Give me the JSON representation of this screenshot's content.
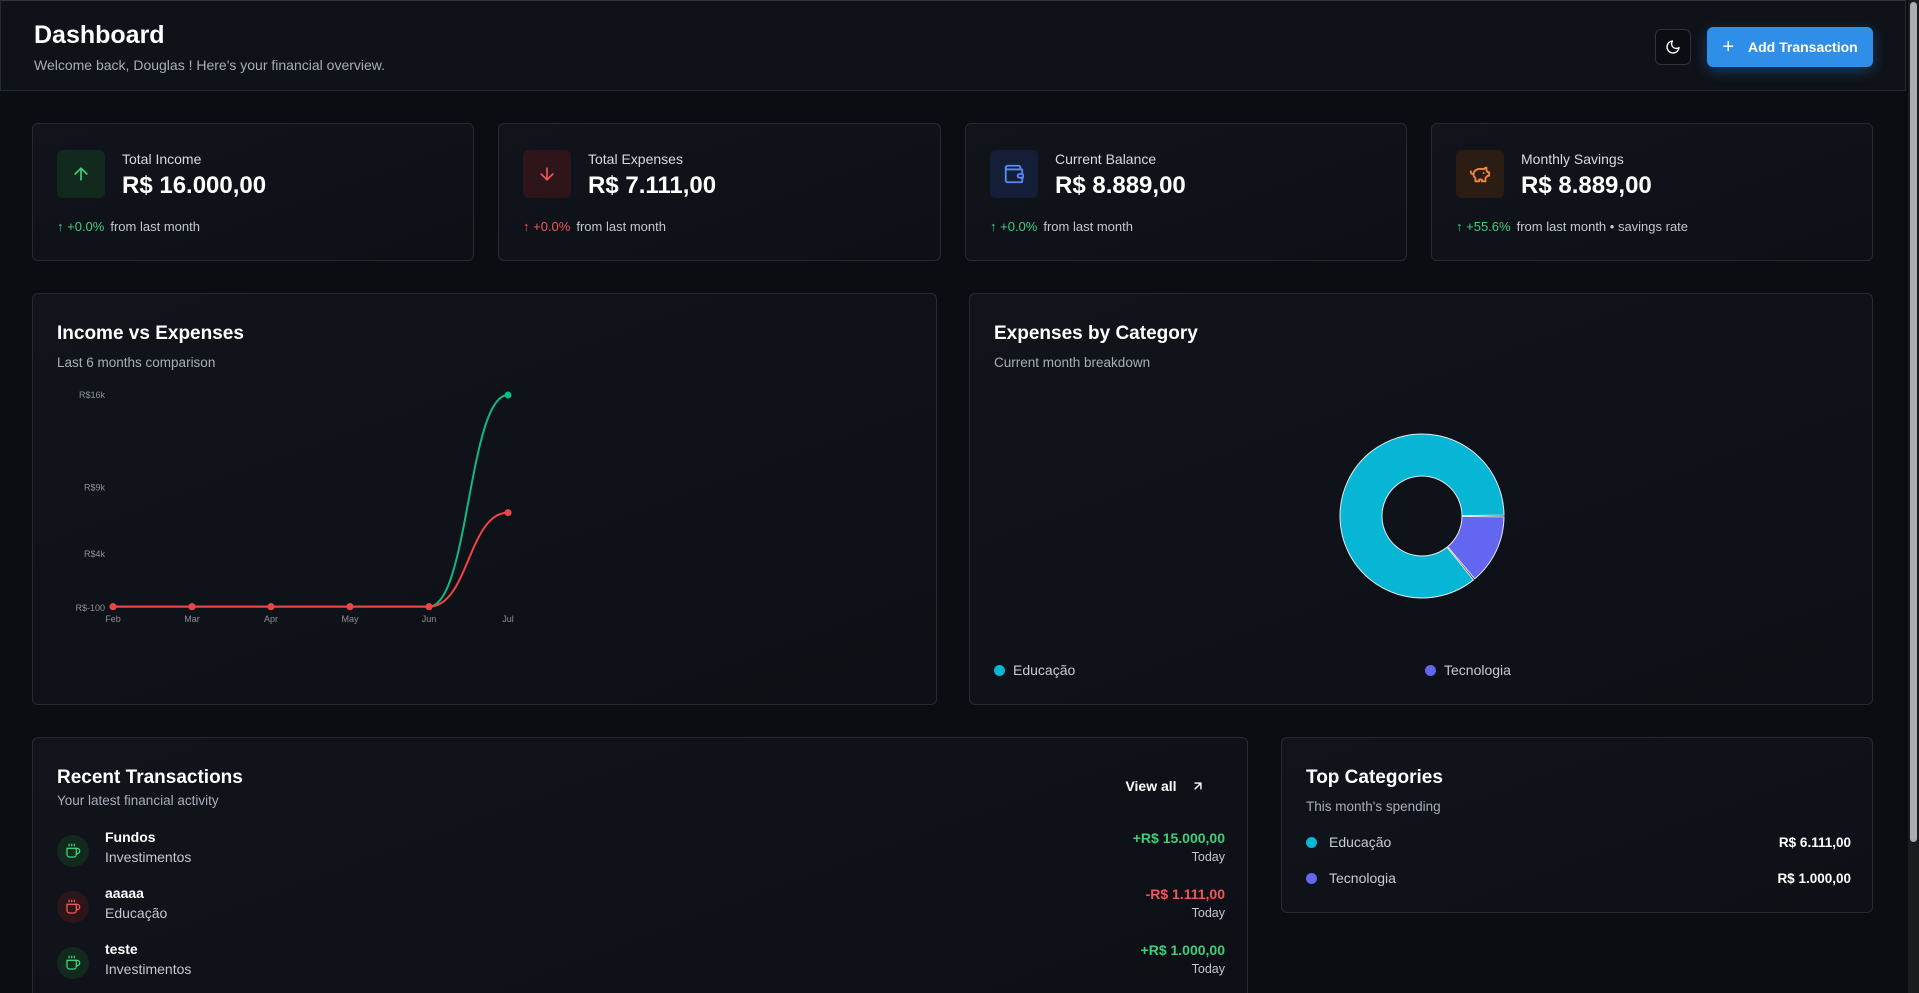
{
  "header": {
    "title": "Dashboard",
    "subtitle": "Welcome back, Douglas ! Here's your financial overview.",
    "add_button": "Add Transaction"
  },
  "stats": [
    {
      "label": "Total Income",
      "value": "R$ 16.000,00",
      "change": "+0.0%",
      "note": "from last month",
      "icon": "arrow-up-icon",
      "color": "#3ecf7a"
    },
    {
      "label": "Total Expenses",
      "value": "R$ 7.111,00",
      "change": "+0.0%",
      "note": "from last month",
      "icon": "arrow-down-icon",
      "color": "#f0565a"
    },
    {
      "label": "Current Balance",
      "value": "R$ 8.889,00",
      "change": "+0.0%",
      "note": "from last month",
      "icon": "wallet-icon",
      "color": "#5b8cf5"
    },
    {
      "label": "Monthly Savings",
      "value": "R$ 8.889,00",
      "change": "+55.6%",
      "note": "from last month • savings rate",
      "icon": "piggy-bank-icon",
      "color": "#f08a3c"
    }
  ],
  "income_chart": {
    "title": "Income vs Expenses",
    "subtitle": "Last 6 months comparison"
  },
  "category_chart": {
    "title": "Expenses by Category",
    "subtitle": "Current month breakdown",
    "legend": [
      {
        "name": "Educação",
        "color": "#06b6d4"
      },
      {
        "name": "Tecnologia",
        "color": "#6366f1"
      }
    ]
  },
  "chart_data": [
    {
      "type": "line",
      "categories": [
        "Feb",
        "Mar",
        "Apr",
        "May",
        "Jun",
        "Jul"
      ],
      "y_ticks": [
        "R$-100",
        "R$4k",
        "R$9k",
        "R$16k"
      ],
      "y_tick_values": [
        -100,
        4000,
        9000,
        16000
      ],
      "ylim": [
        -100,
        16000
      ],
      "series": [
        {
          "key": "income",
          "color": "#10b981",
          "values": [
            0,
            0,
            0,
            0,
            0,
            16000
          ]
        },
        {
          "key": "expenses",
          "color": "#ef4444",
          "values": [
            0,
            0,
            0,
            0,
            0,
            7111
          ]
        }
      ],
      "grid": false
    },
    {
      "type": "pie",
      "labels": [
        "Educação",
        "Tecnologia"
      ],
      "values": [
        6111,
        1000
      ],
      "colors": [
        "#06b6d4",
        "#6366f1"
      ],
      "donut": true
    }
  ],
  "transactions": {
    "title": "Recent Transactions",
    "subtitle": "Your latest financial activity",
    "view_all": "View all",
    "items": [
      {
        "name": "Fundos",
        "category": "Investimentos",
        "amount": "+R$ 15.000,00",
        "date": "Today",
        "type": "income"
      },
      {
        "name": "aaaaa",
        "category": "Educação",
        "amount": "-R$ 1.111,00",
        "date": "Today",
        "type": "expense"
      },
      {
        "name": "teste",
        "category": "Investimentos",
        "amount": "+R$ 1.000,00",
        "date": "Today",
        "type": "income"
      }
    ]
  },
  "top_categories": {
    "title": "Top Categories",
    "subtitle": "This month's spending",
    "items": [
      {
        "name": "Educação",
        "amount": "R$ 6.111,00",
        "color": "#06b6d4"
      },
      {
        "name": "Tecnologia",
        "amount": "R$ 1.000,00",
        "color": "#6366f1"
      }
    ]
  }
}
